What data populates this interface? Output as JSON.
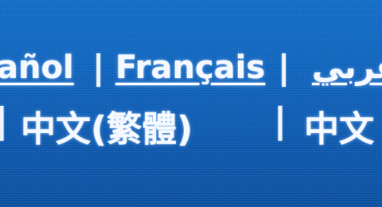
{
  "languages": {
    "row1": {
      "spanish_partial": "añol",
      "french": "Français",
      "arabic_partial": "عربي"
    },
    "row2": {
      "chinese_traditional": "中文(繁體)",
      "chinese_partial": "中文"
    },
    "separator": "|"
  },
  "colors": {
    "background": "#1266c0",
    "text": "#f4f8ff"
  }
}
